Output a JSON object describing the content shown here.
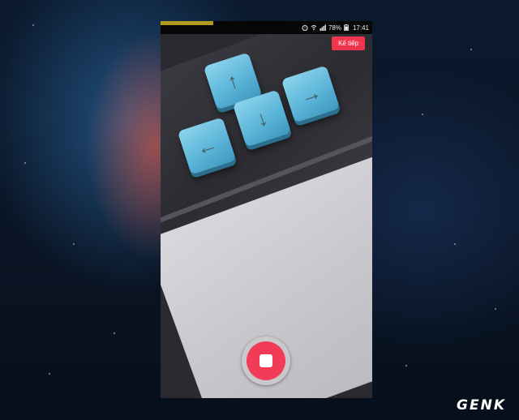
{
  "status_bar": {
    "battery_percent": "78%",
    "time": "17:41",
    "recording_progress": 0.25
  },
  "toolbar": {
    "next_label": "Kế tiếp"
  },
  "keys": [
    {
      "name": "up-key",
      "glyph": "↑"
    },
    {
      "name": "left-key",
      "glyph": "←"
    },
    {
      "name": "down-key",
      "glyph": "↓"
    },
    {
      "name": "right-key",
      "glyph": "→"
    }
  ],
  "watermark": {
    "text": "GENK"
  },
  "icons": [
    "alarm-icon",
    "wifi-icon",
    "signal-icon",
    "battery-icon",
    "stop-icon"
  ],
  "colors": {
    "accent": "#f0354d",
    "progress": "#b49a1c",
    "key": "#5cb6d8"
  }
}
